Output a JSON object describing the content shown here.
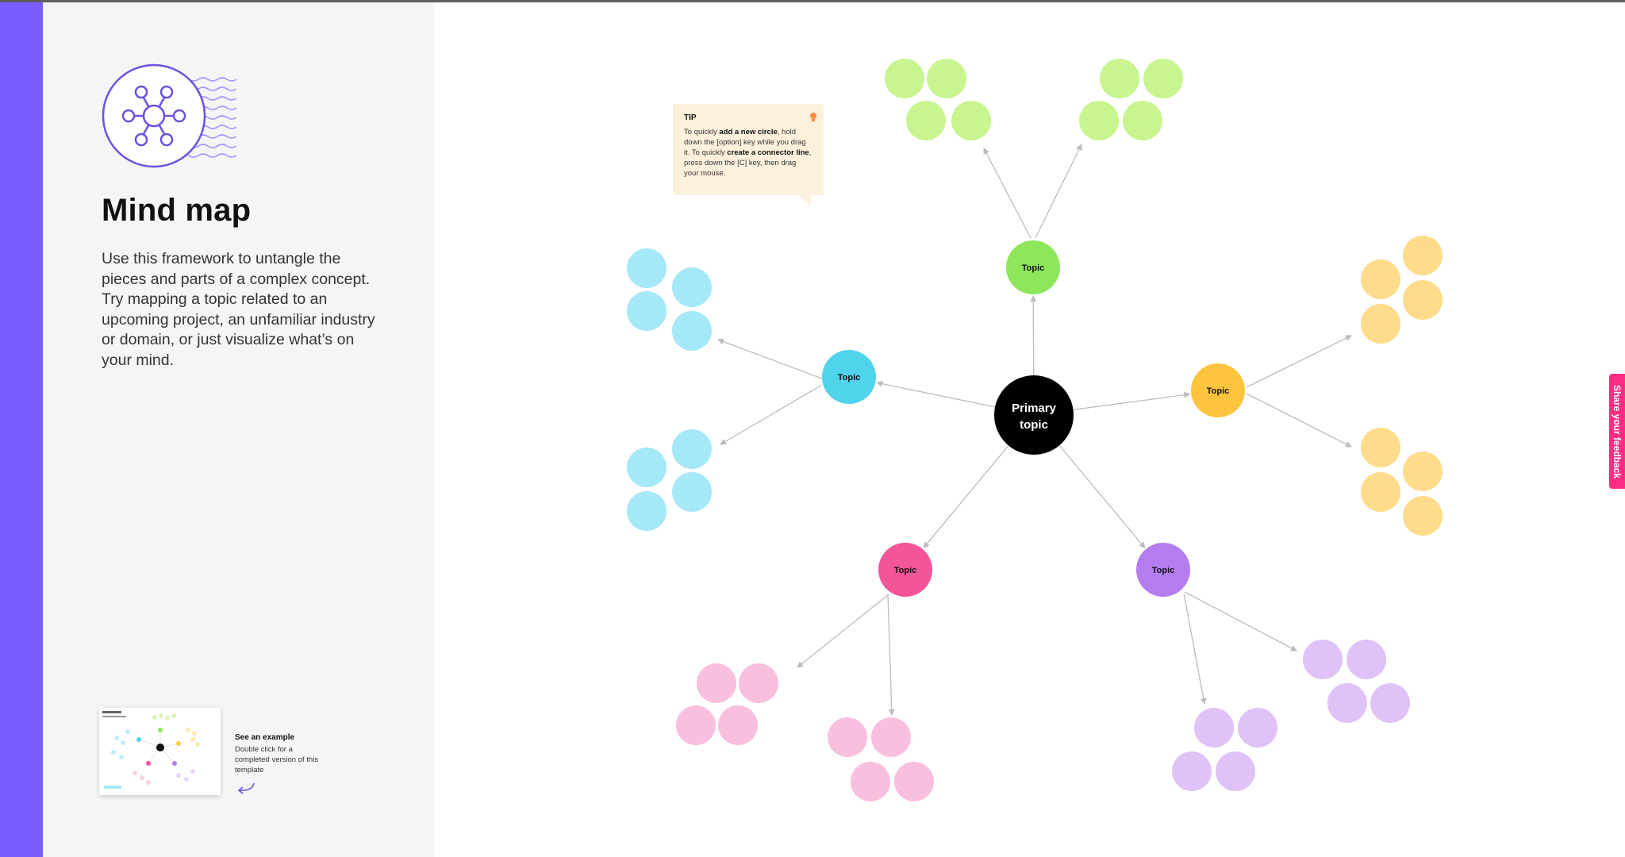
{
  "sidebar": {
    "title": "Mind map",
    "description": "Use this framework to untangle the pieces and parts of a complex concept. Try mapping a topic related to an upcoming project, an unfamiliar industry or domain, or just visualize what’s on your mind.",
    "example": {
      "title": "See an example",
      "subtitle": "Double click for a completed version of this template"
    }
  },
  "tip": {
    "title": "TIP",
    "text_1": "To quickly ",
    "bold_1": "add a new circle",
    "text_2": ", hold down the [option] key while you drag it. To quickly ",
    "bold_2": "create a connector line",
    "text_3": ", press down the [C] key, then drag your mouse."
  },
  "feedback_tab": {
    "label": "Share your feedback"
  },
  "mind_map": {
    "primary": {
      "label_line1": "Primary",
      "label_line2": "topic",
      "color": "#000000"
    },
    "topics": [
      {
        "label": "Topic",
        "color": "#8ee65a",
        "leaf_color": "#c8f58f"
      },
      {
        "label": "Topic",
        "color": "#4fd4ec",
        "leaf_color": "#a5e8f7"
      },
      {
        "label": "Topic",
        "color": "#ffc43d",
        "leaf_color": "#fedc8b"
      },
      {
        "label": "Topic",
        "color": "#f2559a",
        "leaf_color": "#f9bfdf"
      },
      {
        "label": "Topic",
        "color": "#b57cf0",
        "leaf_color": "#dfc2f7"
      }
    ]
  },
  "colors": {
    "accent_purple": "#7b5cff",
    "feedback_pink": "#ff2c86",
    "connector": "#bcbcbc"
  }
}
